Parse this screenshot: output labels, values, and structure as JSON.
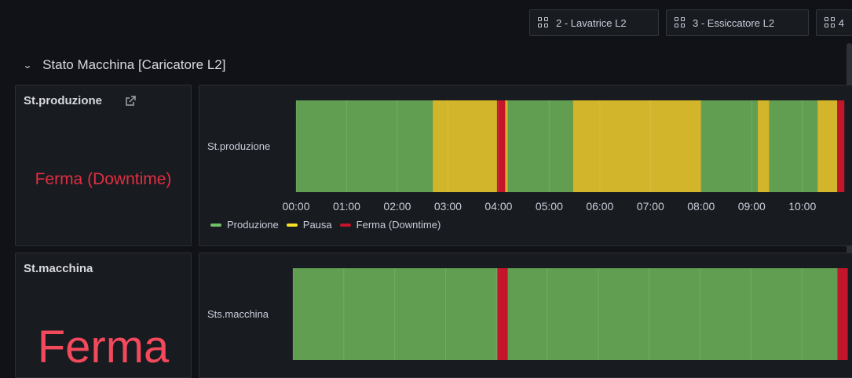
{
  "colors": {
    "produzione": "#629e51",
    "pausa": "#d2b52a",
    "ferma": "#c4162a",
    "stat_red": "#e02f44",
    "background": "#111217",
    "panel": "#181b1f"
  },
  "top_links": [
    {
      "label": "2 - Lavatrice L2",
      "icon": "dashboard-grid-icon"
    },
    {
      "label": "3 - Essiccatore L2",
      "icon": "dashboard-grid-icon"
    },
    {
      "label": "4",
      "icon": "dashboard-grid-icon"
    }
  ],
  "row": {
    "title": "Stato Macchina [Caricatore L2]",
    "icon": "chevron-down-icon"
  },
  "stat_produzione": {
    "title": "St.produzione",
    "value": "Ferma (Downtime)",
    "link_icon": "external-link-icon"
  },
  "stat_macchina": {
    "title": "St.macchina",
    "value": "Ferma"
  },
  "timeline_produzione": {
    "row_label": "St.produzione",
    "legend": [
      {
        "key": "produzione",
        "label": "Produzione"
      },
      {
        "key": "pausa",
        "label": "Pausa"
      },
      {
        "key": "ferma",
        "label": "Ferma (Downtime)"
      }
    ]
  },
  "timeline_macchina": {
    "row_label": "Sts.macchina"
  },
  "chart_data": [
    {
      "type": "state-timeline",
      "row_label": "St.produzione",
      "x_tick_labels": [
        "00:00",
        "01:00",
        "02:00",
        "03:00",
        "04:00",
        "05:00",
        "06:00",
        "07:00",
        "08:00",
        "09:00",
        "10:00"
      ],
      "xlim_hours": [
        0,
        11.4
      ],
      "segments": [
        {
          "start": 0.0,
          "end": 2.7,
          "state": "produzione"
        },
        {
          "start": 2.7,
          "end": 3.97,
          "state": "pausa"
        },
        {
          "start": 3.97,
          "end": 4.13,
          "state": "ferma"
        },
        {
          "start": 4.13,
          "end": 4.18,
          "state": "pausa"
        },
        {
          "start": 4.18,
          "end": 5.47,
          "state": "produzione"
        },
        {
          "start": 5.47,
          "end": 8.0,
          "state": "pausa"
        },
        {
          "start": 8.0,
          "end": 9.12,
          "state": "produzione"
        },
        {
          "start": 9.12,
          "end": 9.35,
          "state": "pausa"
        },
        {
          "start": 9.35,
          "end": 10.3,
          "state": "produzione"
        },
        {
          "start": 10.3,
          "end": 10.69,
          "state": "pausa"
        },
        {
          "start": 10.69,
          "end": 10.83,
          "state": "ferma"
        }
      ],
      "legend": [
        "Produzione",
        "Pausa",
        "Ferma (Downtime)"
      ]
    },
    {
      "type": "state-timeline",
      "row_label": "Sts.macchina",
      "xlim_hours": [
        0,
        11.4
      ],
      "segments": [
        {
          "start": 0.0,
          "end": 4.02,
          "state": "produzione"
        },
        {
          "start": 4.02,
          "end": 4.22,
          "state": "ferma"
        },
        {
          "start": 4.22,
          "end": 10.7,
          "state": "produzione"
        },
        {
          "start": 10.7,
          "end": 10.9,
          "state": "ferma"
        }
      ]
    }
  ]
}
